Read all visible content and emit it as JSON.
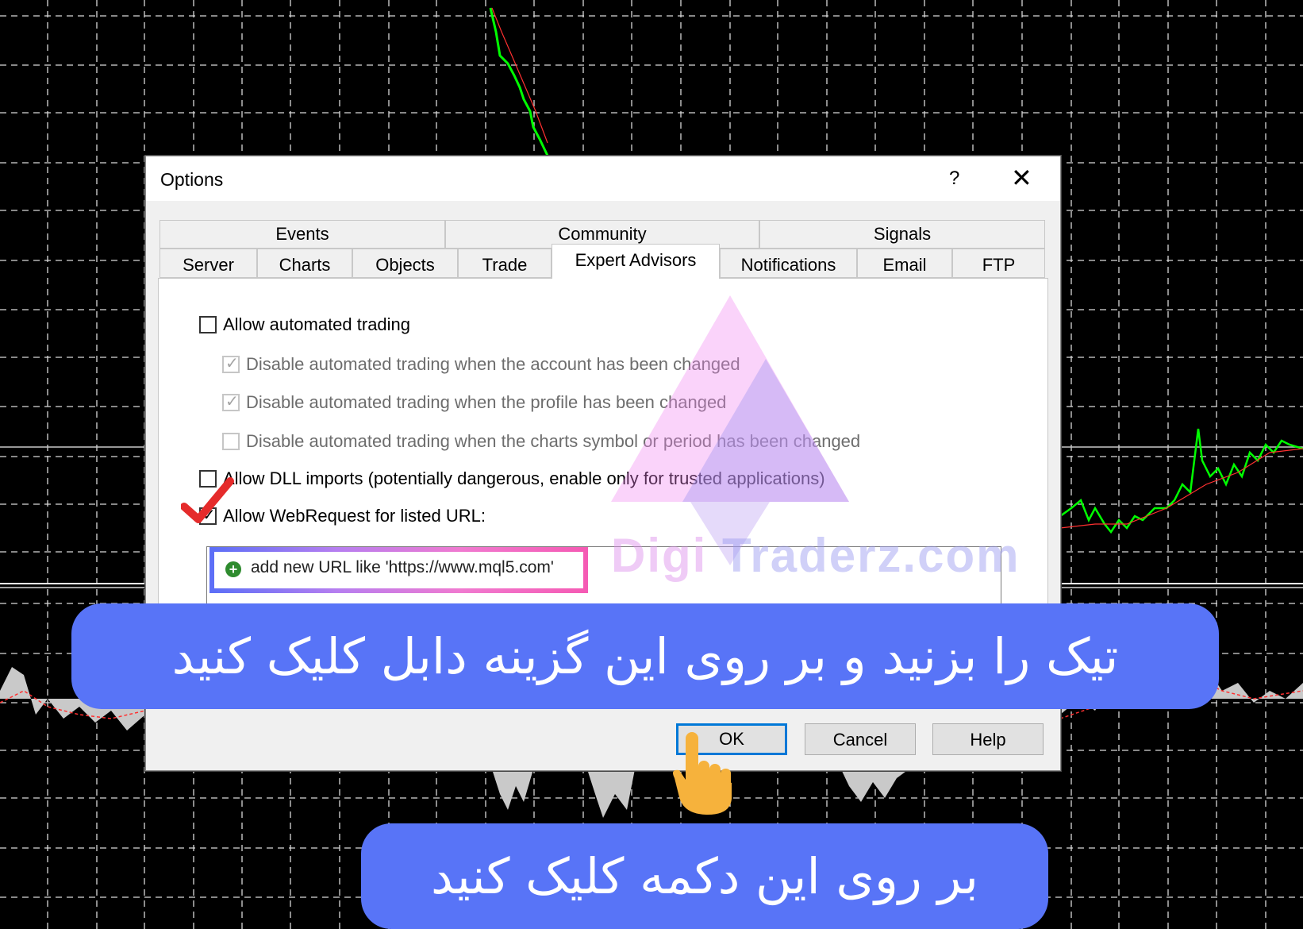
{
  "dialog": {
    "title": "Options",
    "help_label": "?",
    "close_label": "✕"
  },
  "tabs": {
    "row1": [
      "Events",
      "Community",
      "Signals"
    ],
    "row2": [
      "Server",
      "Charts",
      "Objects",
      "Trade",
      "Expert Advisors",
      "Notifications",
      "Email",
      "FTP"
    ],
    "active": "Expert Advisors"
  },
  "options": {
    "allow_automated_trading": {
      "label": "Allow automated trading",
      "checked": false
    },
    "disable_on_account_change": {
      "label": "Disable automated trading when the account has been changed",
      "checked": true,
      "disabled": true
    },
    "disable_on_profile_change": {
      "label": "Disable automated trading when the profile has been changed",
      "checked": true,
      "disabled": true
    },
    "disable_on_symbol_change": {
      "label": "Disable automated trading when the charts symbol or period has been changed",
      "checked": false,
      "disabled": true
    },
    "allow_dll": {
      "label": "Allow DLL imports (potentially dangerous, enable only for trusted applications)",
      "checked": false
    },
    "allow_webrequest": {
      "label": "Allow WebRequest for listed URL:",
      "checked": true
    }
  },
  "url_list": {
    "add_text": "add new URL like 'https://www.mql5.com'"
  },
  "buttons": {
    "ok": "OK",
    "cancel": "Cancel",
    "help": "Help"
  },
  "watermark": {
    "part1": "Digi",
    "part2": "Traderz.com"
  },
  "banners": {
    "top": "تیک را بزنید و بر روی این گزینه دابل کلیک کنید",
    "bottom": "بر روی این دکمه کلیک کنید"
  },
  "colors": {
    "banner_bg": "#5874f7",
    "chart_bg": "#000000",
    "chart_line": "#00ff00",
    "ok_focus": "#0078d7"
  },
  "icons": [
    "add-url-icon",
    "red-check-mark-icon",
    "pointing-hand-icon",
    "close-icon",
    "help-icon"
  ]
}
